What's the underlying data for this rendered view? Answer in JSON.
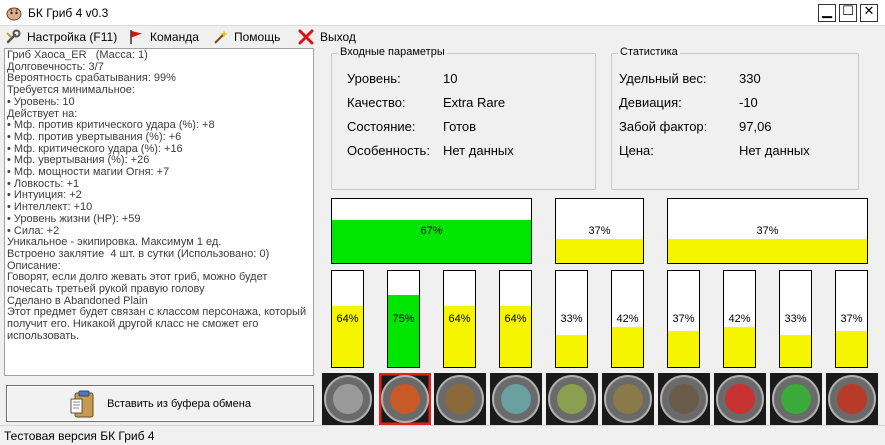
{
  "window": {
    "title": "БК Гриб 4 v0.3",
    "minimize_glyph": "▁",
    "maximize_glyph": "☐",
    "close_glyph": "✕"
  },
  "menu": [
    {
      "label": "Настройка (F11)",
      "icon": "wrench-icon"
    },
    {
      "label": "Команда",
      "icon": "red-flag-icon"
    },
    {
      "label": "Помощь",
      "icon": "magic-wand-icon"
    },
    {
      "label": "Выход",
      "icon": "red-x-icon"
    }
  ],
  "description": "Гриб Хаоса_ER   (Масса: 1)\nДолговечность: 3/7\nВероятность срабатывания: 99%\nТребуется минимальное:\n• Уровень: 10\nДействует на:\n• Мф. против критического удара (%): +8\n• Мф. против увертывания (%): +6\n• Мф. критического удара (%): +16\n• Мф. увертывания (%): +26\n• Мф. мощности магии Огня: +7\n• Ловкость: +1\n• Интуиция: +2\n• Интеллект: +10\n• Уровень жизни (HP): +59\n• Сила: +2\nУникальное - экипировка. Максимум 1 ед.\nВстроено заклятие  4 шт. в сутки (Использовано: 0)\nОписание:\nГоворят, если долго жевать этот гриб, можно будет\nпочесать третьей рукой правую голову\nСделано в Abandoned Plain\nЭтот предмет будет связан с классом персонажа, который\nполучит его. Никакой другой класс не сможет его\nиспользовать.",
  "paste_button": {
    "label": "Вставить из буфера обмена"
  },
  "input_params": {
    "title": "Входные параметры",
    "rows": [
      {
        "label": "Уровень:",
        "value": "10"
      },
      {
        "label": "Качество:",
        "value": "Extra Rare"
      },
      {
        "label": "Состояние:",
        "value": "Готов"
      },
      {
        "label": "Особенность:",
        "value": "Нет данных"
      }
    ]
  },
  "statistics": {
    "title": "Статистика",
    "rows": [
      {
        "label": "Удельный вес:",
        "value": "330"
      },
      {
        "label": "Девиация:",
        "value": "-10"
      },
      {
        "label": "Забой фактор:",
        "value": "97,06"
      },
      {
        "label": "Цена:",
        "value": "Нет данных"
      }
    ]
  },
  "colors": {
    "green": "#00e600",
    "yellow": "#f5f500",
    "window_bg": "#f0f0f0"
  },
  "top_bars": [
    {
      "label": "67%",
      "fraction": 0.67,
      "color": "green"
    },
    {
      "label": "37%",
      "fraction": 0.37,
      "color": "yellow"
    },
    {
      "label": "37%",
      "fraction": 0.37,
      "color": "yellow"
    }
  ],
  "small_bars": [
    {
      "label": "64%",
      "fraction": 0.64,
      "color": "yellow"
    },
    {
      "label": "75%",
      "fraction": 0.75,
      "color": "green"
    },
    {
      "label": "64%",
      "fraction": 0.64,
      "color": "yellow"
    },
    {
      "label": "64%",
      "fraction": 0.64,
      "color": "yellow"
    },
    {
      "label": "33%",
      "fraction": 0.33,
      "color": "yellow"
    },
    {
      "label": "42%",
      "fraction": 0.42,
      "color": "yellow"
    },
    {
      "label": "37%",
      "fraction": 0.37,
      "color": "yellow"
    },
    {
      "label": "42%",
      "fraction": 0.42,
      "color": "yellow"
    },
    {
      "label": "33%",
      "fraction": 0.33,
      "color": "yellow"
    },
    {
      "label": "37%",
      "fraction": 0.37,
      "color": "yellow"
    }
  ],
  "ingredients": [
    {
      "icon": "gray-stone-icon",
      "color": "#9a9a9a",
      "selected": false
    },
    {
      "icon": "flame-flower-icon",
      "color": "#c85a28",
      "selected": true
    },
    {
      "icon": "brown-roots-icon",
      "color": "#8a6a3a",
      "selected": false
    },
    {
      "icon": "lotus-flower-icon",
      "color": "#6aa0a0",
      "selected": false
    },
    {
      "icon": "mushroom-icon",
      "color": "#8aa050",
      "selected": false
    },
    {
      "icon": "sticks-bundle-icon",
      "color": "#8a7a4a",
      "selected": false
    },
    {
      "icon": "brown-cube-icon",
      "color": "#6a5a4a",
      "selected": false
    },
    {
      "icon": "red-pepper-icon",
      "color": "#c83232",
      "selected": false
    },
    {
      "icon": "green-clover-icon",
      "color": "#3aaa3a",
      "selected": false
    },
    {
      "icon": "red-berry-icon",
      "color": "#b83a28",
      "selected": false
    }
  ],
  "status_bar": {
    "text": "Тестовая версия БК Гриб 4"
  }
}
